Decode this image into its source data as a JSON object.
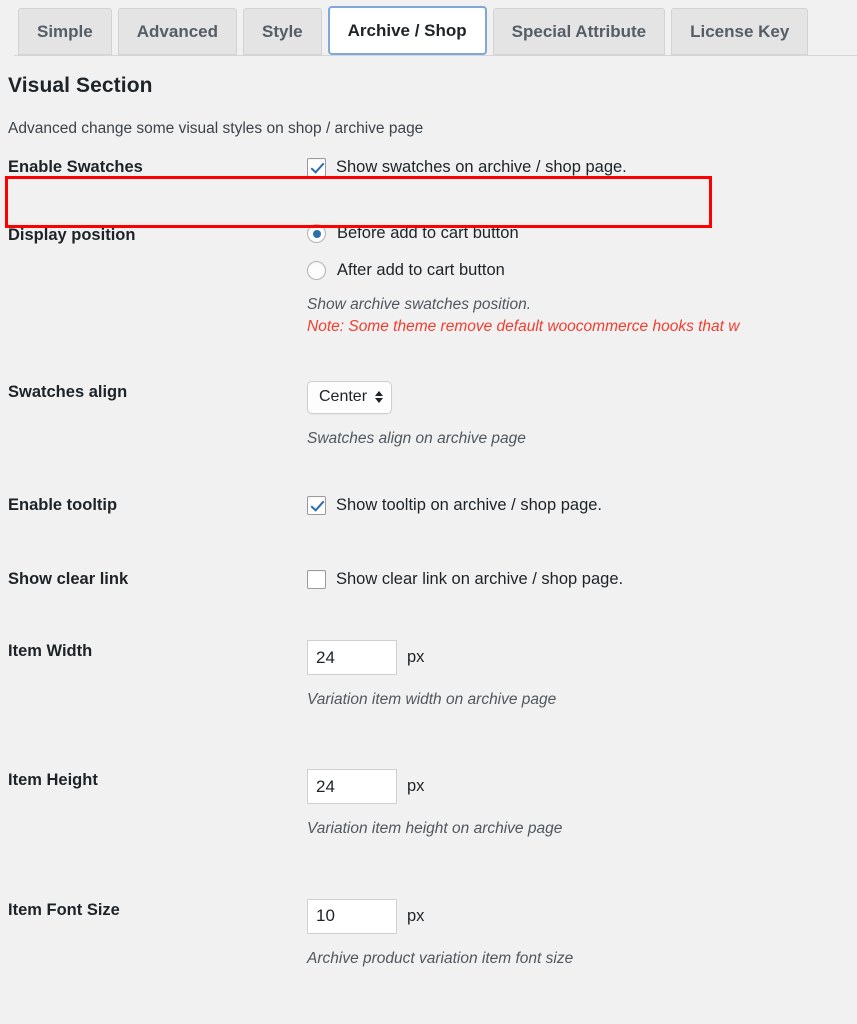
{
  "tabs": [
    {
      "label": "Simple",
      "active": false
    },
    {
      "label": "Advanced",
      "active": false
    },
    {
      "label": "Style",
      "active": false
    },
    {
      "label": "Archive / Shop",
      "active": true
    },
    {
      "label": "Special Attribute",
      "active": false
    },
    {
      "label": "License Key",
      "active": false
    }
  ],
  "section": {
    "title": "Visual Section",
    "description": "Advanced change some visual styles on shop / archive page"
  },
  "fields": {
    "enable_swatches": {
      "label": "Enable Swatches",
      "checkbox_label": "Show swatches on archive / shop page.",
      "checked": true
    },
    "display_position": {
      "label": "Display position",
      "options": [
        {
          "label": "Before add to cart button",
          "selected": true
        },
        {
          "label": "After add to cart button",
          "selected": false
        }
      ],
      "description": "Show archive swatches position.",
      "note": "Note: Some theme remove default woocommerce hooks that w"
    },
    "swatches_align": {
      "label": "Swatches align",
      "value": "Center",
      "description": "Swatches align on archive page"
    },
    "enable_tooltip": {
      "label": "Enable tooltip",
      "checkbox_label": "Show tooltip on archive / shop page.",
      "checked": true
    },
    "show_clear_link": {
      "label": "Show clear link",
      "checkbox_label": "Show clear link on archive / shop page.",
      "checked": false
    },
    "item_width": {
      "label": "Item Width",
      "value": "24",
      "unit": "px",
      "description": "Variation item width on archive page"
    },
    "item_height": {
      "label": "Item Height",
      "value": "24",
      "unit": "px",
      "description": "Variation item height on archive page"
    },
    "item_font_size": {
      "label": "Item Font Size",
      "value": "10",
      "unit": "px",
      "description": "Archive product variation item font size"
    }
  },
  "annotation": {
    "highlight_color": "#ff0000"
  }
}
